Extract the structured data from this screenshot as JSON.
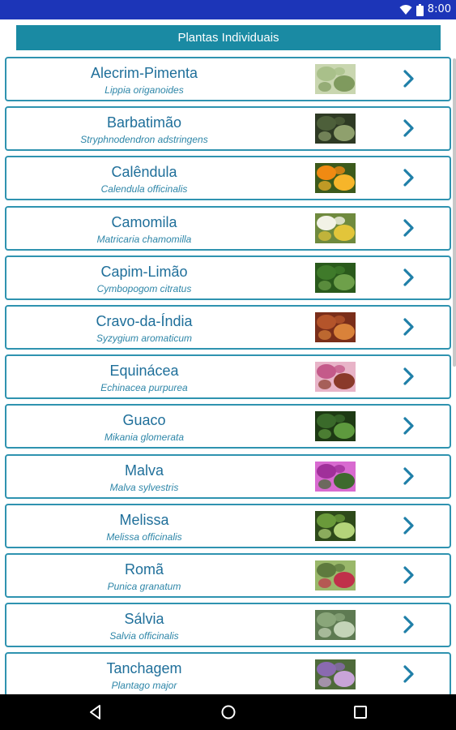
{
  "status_bar": {
    "time": "8:00",
    "icons": [
      "wifi-icon",
      "battery-icon"
    ]
  },
  "header": {
    "title": "Plantas Individuais"
  },
  "plants": [
    {
      "name": "Alecrim-Pimenta",
      "scientific": "Lippia origanoides",
      "image": "alecrim-pimenta-image"
    },
    {
      "name": "Barbatimão",
      "scientific": "Stryphnodendron adstringens",
      "image": "barbatimao-image"
    },
    {
      "name": "Calêndula",
      "scientific": "Calendula officinalis",
      "image": "calendula-image"
    },
    {
      "name": "Camomila",
      "scientific": "Matricaria chamomilla",
      "image": "camomila-image"
    },
    {
      "name": "Capim-Limão",
      "scientific": "Cymbopogom citratus",
      "image": "capim-limao-image"
    },
    {
      "name": "Cravo-da-Índia",
      "scientific": "Syzygium aromaticum",
      "image": "cravo-da-india-image"
    },
    {
      "name": "Equinácea",
      "scientific": "Echinacea purpurea",
      "image": "equinacea-image"
    },
    {
      "name": "Guaco",
      "scientific": "Mikania glomerata",
      "image": "guaco-image"
    },
    {
      "name": "Malva",
      "scientific": "Malva sylvestris",
      "image": "malva-image"
    },
    {
      "name": "Melissa",
      "scientific": "Melissa officinalis",
      "image": "melissa-image"
    },
    {
      "name": "Romã",
      "scientific": "Punica granatum",
      "image": "roma-image"
    },
    {
      "name": "Sálvia",
      "scientific": "Salvia officinalis",
      "image": "salvia-image"
    },
    {
      "name": "Tanchagem",
      "scientific": "Plantago major",
      "image": "tanchagem-image"
    }
  ],
  "colors": {
    "status_bar": "#1c35b8",
    "header": "#1a8aa3",
    "border": "#2f93b0",
    "title_text": "#1f6f9a",
    "subtitle_text": "#2e86a8"
  },
  "nav_bar": {
    "buttons": [
      "back-icon",
      "home-icon",
      "recents-icon"
    ]
  }
}
